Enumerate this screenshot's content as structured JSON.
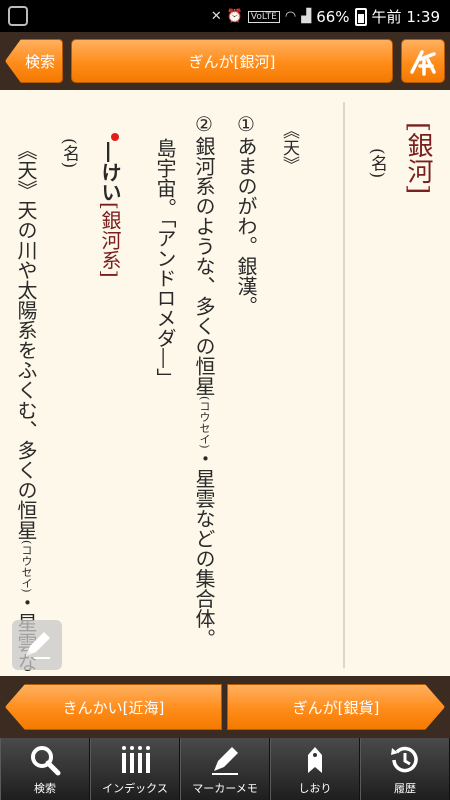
{
  "status_bar": {
    "battery": "66%",
    "time": "午前 1:39",
    "lte": "VoLTE"
  },
  "header": {
    "back_label": "検索",
    "title": "ぎんが[銀河]"
  },
  "entry": {
    "headword": "[銀河]",
    "pos": "(名)",
    "category": "《天》",
    "sense1_num": "①",
    "sense1_text": "あまのがわ。銀漢。",
    "sense2_num": "②",
    "sense2_text_a": "銀河系のような、多くの恒星",
    "sense2_ruby": "(コウセイ)",
    "sense2_text_b": "・星雲などの集合体。",
    "sense2_text_c": "島宇宙。「アンドロメダ―」"
  },
  "subentry": {
    "prefix": "―けい",
    "head": "[銀河系]",
    "pos": "(名)",
    "text_a": "《天》天の川や太陽系をふくむ、多くの恒星",
    "ruby": "(コウセイ)",
    "text_b": "・星雲な"
  },
  "nav": {
    "prev_label": "きんかい[近海]",
    "next_label": "ぎんが[銀貨]"
  },
  "toolbar": {
    "search_label": "検索",
    "index_label": "インデックス",
    "marker_label": "マーカーメモ",
    "bookmark_label": "しおり",
    "history_label": "履歴"
  },
  "colors": {
    "accent_orange": "#ff8c1a",
    "headword_maroon": "#7a1e1e",
    "background_cream": "#fdf8e9"
  }
}
